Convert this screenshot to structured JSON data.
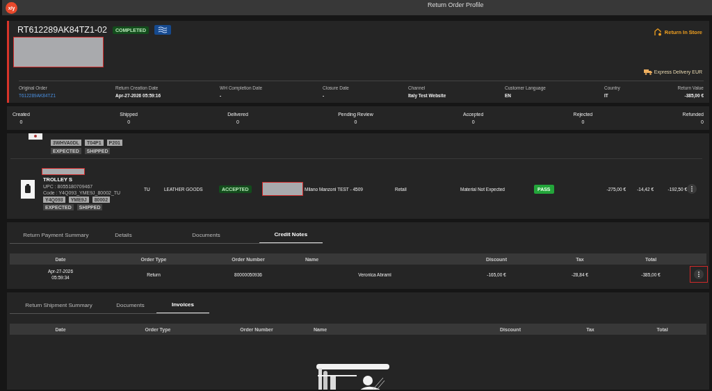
{
  "window": {
    "logo": "x/y",
    "title": "Return Order Profile"
  },
  "order": {
    "number": "RT612289AK84TZ1-02",
    "status": "COMPLETED",
    "store_action": "Return In Store",
    "delivery": "Express Delivery EUR",
    "fields": [
      {
        "label": "Original Order",
        "value": "T612289AK84TZ1",
        "kind": "link"
      },
      {
        "label": "Return Creation Date",
        "value": "Apr-27-2026 05:59:16",
        "kind": "text"
      },
      {
        "label": "WH Completion Date",
        "value": "-",
        "kind": "text"
      },
      {
        "label": "Closure Date",
        "value": "-",
        "kind": "text"
      },
      {
        "label": "Channel",
        "value": "Italy Test Website",
        "kind": "text"
      },
      {
        "label": "Customer Language",
        "value": "EN",
        "kind": "text"
      },
      {
        "label": "Country",
        "value": "IT",
        "kind": "text"
      },
      {
        "label": "Return Value",
        "value": "-385,00 €",
        "kind": "text"
      }
    ]
  },
  "counters": [
    {
      "label": "Created",
      "value": "0"
    },
    {
      "label": "Shipped",
      "value": "0"
    },
    {
      "label": "Delivered",
      "value": "0"
    },
    {
      "label": "Pending Review",
      "value": "0"
    },
    {
      "label": "Accepted",
      "value": "0"
    },
    {
      "label": "Rejected",
      "value": "0"
    },
    {
      "label": "Refunded",
      "value": "0"
    }
  ],
  "items": [
    {
      "kind": "partial",
      "codes": [
        "3WHVA0DL",
        "T04P1",
        "P201"
      ],
      "statuses": [
        "EXPECTED",
        "SHIPPED"
      ]
    },
    {
      "kind": "full",
      "name": "TROLLEY S",
      "upc": "UPC : 8055180709467",
      "code": "Code : Y4Q093_YME9J_80002_TU",
      "codes": [
        "Y4Q093",
        "YME9J",
        "80002"
      ],
      "statuses": [
        "EXPECTED",
        "SHIPPED"
      ],
      "size": "TU",
      "category": "LEATHER GOODS",
      "status": "ACCEPTED",
      "store": "Milano Manzoni TEST - 4509",
      "channel": "Retail",
      "reason": "Material Not Expected",
      "check": "PASS",
      "amount": "-275,00 €",
      "tax": "-14,42 €",
      "refund": "-192,50 €"
    }
  ],
  "payment": {
    "tabs": [
      {
        "label": "Return Payment Summary",
        "selected": false
      },
      {
        "label": "Details",
        "selected": false
      },
      {
        "label": "Documents",
        "selected": false
      },
      {
        "label": "Credit Notes",
        "selected": true
      }
    ],
    "columns": [
      "Date",
      "Order Type",
      "Order Number",
      "Name",
      "Discount",
      "Tax",
      "Total"
    ],
    "rows": [
      {
        "date": "Apr-27-2026",
        "time": "05:59:34",
        "order_type": "Return",
        "order_number": "80000050936",
        "name": "Veronica Abrami",
        "discount": "-165,00 €",
        "tax": "-28,84 €",
        "total": "-385,00 €",
        "highlighted": true
      }
    ]
  },
  "shipment": {
    "tabs": [
      {
        "label": "Return Shipment Summary",
        "selected": false
      },
      {
        "label": "Documents",
        "selected": false
      },
      {
        "label": "Invoices",
        "selected": true
      }
    ],
    "columns": [
      "Date",
      "Order Type",
      "Order Number",
      "Name",
      "Discount",
      "Tax",
      "Total"
    ]
  }
}
